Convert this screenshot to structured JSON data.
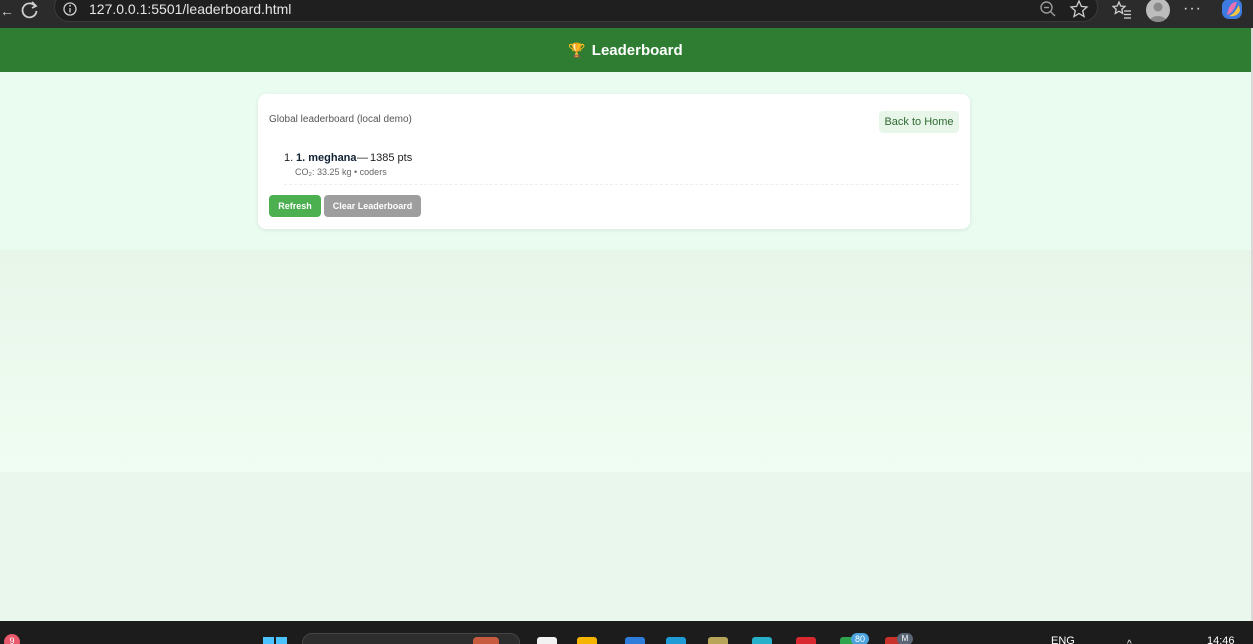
{
  "browser": {
    "url": "127.0.0.1:5501/leaderboard.html",
    "more_label": "···"
  },
  "app": {
    "title": "Leaderboard",
    "trophy": "🏆"
  },
  "leaderboard": {
    "subtitle": "Global leaderboard (local demo)",
    "back_home_label": "Back to Home",
    "entries": [
      {
        "rank": "1.",
        "name": "1. meghana",
        "separator": "—",
        "points": "1385 pts",
        "detail": "CO₂: 33.25 kg • coders"
      }
    ],
    "refresh_label": "Refresh",
    "clear_label": "Clear Leaderboard"
  },
  "colors": {
    "header_green": "#2e7d32",
    "refresh_green": "#4caf50",
    "clear_gray": "#9e9e9e",
    "page_bg": "#ecf8ee"
  },
  "taskbar": {
    "notification_count": "9",
    "app_badge_count": "80",
    "profile_initial": "M",
    "language": "ENG",
    "time": "14:46"
  }
}
